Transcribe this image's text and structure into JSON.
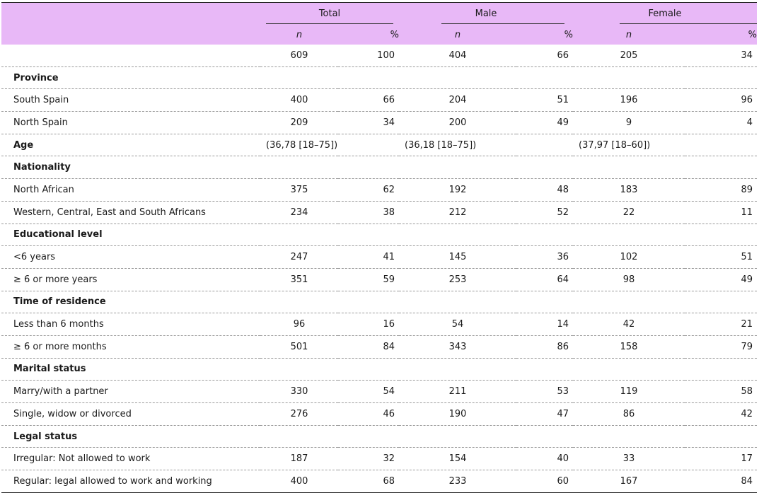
{
  "header": {
    "groups": [
      "Total",
      "Male",
      "Female"
    ],
    "sub": [
      "n",
      "%"
    ]
  },
  "rows": [
    {
      "type": "data",
      "label": "",
      "vals": [
        "609",
        "100",
        "404",
        "66",
        "205",
        "34"
      ]
    },
    {
      "type": "section",
      "label": "Province"
    },
    {
      "type": "data",
      "label": "South Spain",
      "vals": [
        "400",
        "66",
        "204",
        "51",
        "196",
        "96"
      ]
    },
    {
      "type": "data",
      "label": "North Spain",
      "vals": [
        "209",
        "34",
        "200",
        "49",
        "9",
        "4"
      ]
    },
    {
      "type": "span",
      "label": "Age",
      "vals": [
        "(36,78 [18–75])",
        "(36,18 [18–75])",
        "(37,97 [18–60])"
      ]
    },
    {
      "type": "section",
      "label": "Nationality"
    },
    {
      "type": "data",
      "label": "North African",
      "vals": [
        "375",
        "62",
        "192",
        "48",
        "183",
        "89"
      ]
    },
    {
      "type": "data",
      "label": "Western, Central, East and South Africans",
      "vals": [
        "234",
        "38",
        "212",
        "52",
        "22",
        "11"
      ]
    },
    {
      "type": "section",
      "label": "Educational level"
    },
    {
      "type": "data",
      "label": "<6 years",
      "vals": [
        "247",
        "41",
        "145",
        "36",
        "102",
        "51"
      ]
    },
    {
      "type": "data",
      "label": "≥ 6 or more years",
      "vals": [
        "351",
        "59",
        "253",
        "64",
        "98",
        "49"
      ]
    },
    {
      "type": "section",
      "label": "Time of residence"
    },
    {
      "type": "data",
      "label": "Less than 6 months",
      "vals": [
        "96",
        "16",
        "54",
        "14",
        "42",
        "21"
      ]
    },
    {
      "type": "data",
      "label": "≥ 6 or more months",
      "vals": [
        "501",
        "84",
        "343",
        "86",
        "158",
        "79"
      ]
    },
    {
      "type": "section",
      "label": "Marital status"
    },
    {
      "type": "data",
      "label": "Marry/with a partner",
      "vals": [
        "330",
        "54",
        "211",
        "53",
        "119",
        "58"
      ]
    },
    {
      "type": "data",
      "label": "Single, widow or divorced",
      "vals": [
        "276",
        "46",
        "190",
        "47",
        "86",
        "42"
      ]
    },
    {
      "type": "section",
      "label": "Legal status"
    },
    {
      "type": "data",
      "label": "Irregular: Not allowed to work",
      "vals": [
        "187",
        "32",
        "154",
        "40",
        "33",
        "17"
      ]
    },
    {
      "type": "data",
      "label": "Regular: legal allowed to work and working",
      "vals": [
        "400",
        "68",
        "233",
        "60",
        "167",
        "84"
      ]
    }
  ]
}
